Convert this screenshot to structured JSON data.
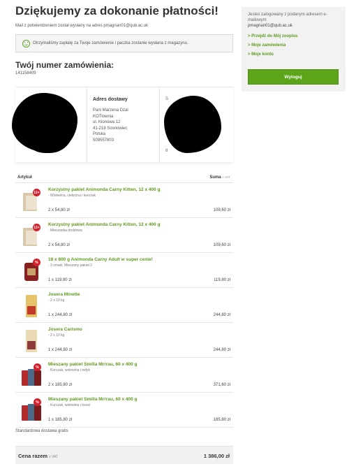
{
  "header": {
    "title": "Dziękujemy za dokonanie płatności!",
    "mail_info": "Mail z potwierdzeniem został wysłany na adres pmagrian01@qub.ac.uk",
    "confirm_text": "Otrzymaliśmy zapłatę za Twoje zamówienie i paczka zostanie wysłana z magazynu.",
    "order_title": "Twój numer zamówienia:",
    "order_number": "141158409"
  },
  "addresses": {
    "delivery_heading": "Adres dostawy",
    "delivery_lines": [
      "Pani Marzena Dzal",
      "KOTlownia",
      "ul. Klonowa 12",
      "41-218 Sosnowiec",
      "Polska",
      "509557803"
    ],
    "col1_visible_fragment": "a",
    "col3_visible_fragment": "S",
    "col3_visible_fragment2": "8"
  },
  "items_header": {
    "article": "Artykuł",
    "sum": "Suma",
    "vat": "z VAT"
  },
  "items": [
    {
      "name": "Korzystny pakiet Animonda Carny Kitten, 12 x 400 g",
      "desc": "- Wołowina, cielęcina i kurczak",
      "qty": "2 x 54,80 zł",
      "total": "109,60 zł",
      "badge": "12+"
    },
    {
      "name": "Korzystny pakiet Animonda Carny Kitten, 12 x 400 g",
      "desc": "- Mieszanka drobiowa",
      "qty": "2 x 54,80 zł",
      "total": "109,60 zł",
      "badge": "12+"
    },
    {
      "name": "18 x 800 g Animonda Carny Adult w super cenie!",
      "desc": "- 3 smaki, Mieszany pakiet 2",
      "qty": "1 x 119,80 zł",
      "total": "119,80 zł",
      "badge": "%"
    },
    {
      "name": "Josera Minette",
      "desc": "- 2 x 10 kg",
      "qty": "1 x 244,80 zł",
      "total": "244,80 zł",
      "badge": ""
    },
    {
      "name": "Josera Carismo",
      "desc": "- 2 x 10 kg",
      "qty": "1 x 244,80 zł",
      "total": "244,80 zł",
      "badge": ""
    },
    {
      "name": "Mieszany pakiet Smilla Mrrrau, 60 x 400 g",
      "desc": "- Kurczak, wołowina i indyk",
      "qty": "2 x 185,80 zł",
      "total": "371,60 zł",
      "badge": "%"
    },
    {
      "name": "Mieszany pakiet Smilla Mrrrau, 60 x 400 g",
      "desc": "- Kurczak, wołowina i łosoś",
      "qty": "1 x 185,80 zł",
      "total": "185,80 zł",
      "badge": "%"
    }
  ],
  "footer": {
    "shipping": "Standardowa dostawa gratis",
    "total_label": "Cena razem",
    "total_vat": "z VAT",
    "total_value": "1 386,00 zł"
  },
  "sidebar": {
    "info": "Jesteś zalogowany z podanym adresem e-mailowym",
    "email": "pmagrian01@qub.ac.uk",
    "links": [
      "> Przejdź do Mój zooplus",
      "> Moje zamówienia",
      "> Moje konto"
    ],
    "logout": "Wyloguj"
  },
  "colors": {
    "accent_green": "#5ca51a",
    "link_green": "#5d9a1b",
    "badge_red": "#d4202b"
  }
}
